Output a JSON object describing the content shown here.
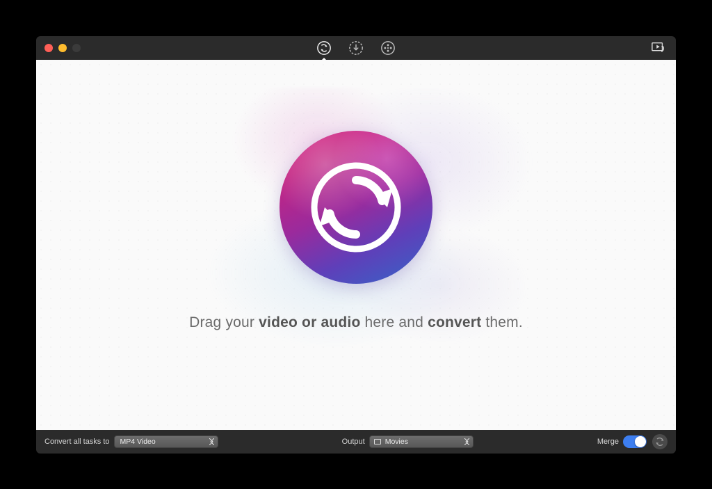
{
  "toolbar": {
    "tabs": [
      {
        "name": "convert-icon",
        "active": true
      },
      {
        "name": "download-icon",
        "active": false
      },
      {
        "name": "movie-icon",
        "active": false
      }
    ],
    "right_icon": "media-library-icon"
  },
  "content": {
    "instruction_prefix": "Drag your ",
    "instruction_bold1": "video or audio",
    "instruction_mid": " here and ",
    "instruction_bold2": "convert",
    "instruction_suffix": " them."
  },
  "footer": {
    "convert_all_label": "Convert all tasks to",
    "convert_all_value": "MP4 Video",
    "output_label": "Output",
    "output_value": "Movies",
    "merge_label": "Merge",
    "merge_on": true
  }
}
